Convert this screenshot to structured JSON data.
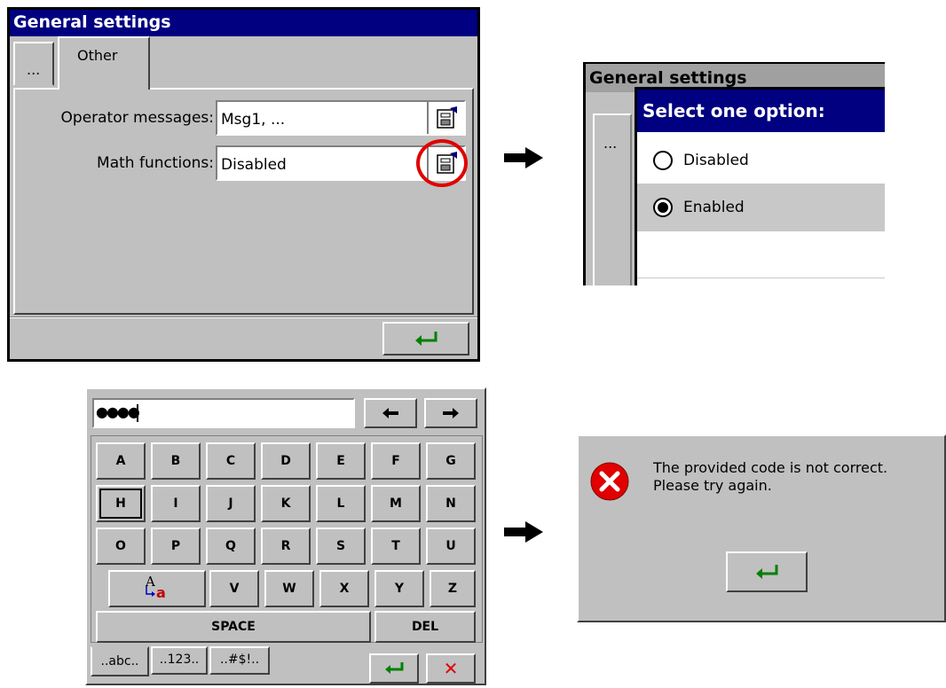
{
  "settings": {
    "title": "General settings",
    "tabs": [
      {
        "label": "..."
      },
      {
        "label": "Other"
      }
    ],
    "fields": [
      {
        "label": "Operator messages:",
        "value": "Msg1, ..."
      },
      {
        "label": "Math functions:",
        "value": "Disabled"
      }
    ],
    "highlight_color": "#e00000"
  },
  "select_dialog": {
    "bg_title_partial": "General settings",
    "bg_tab": "...",
    "title": "Select one option:",
    "options": [
      {
        "label": "Disabled",
        "selected": false
      },
      {
        "label": "Enabled",
        "selected": true
      }
    ]
  },
  "keyboard": {
    "password_value": "●●●●",
    "rows": [
      [
        "A",
        "B",
        "C",
        "D",
        "E",
        "F",
        "G"
      ],
      [
        "H",
        "I",
        "J",
        "K",
        "L",
        "M",
        "N"
      ],
      [
        "O",
        "P",
        "Q",
        "R",
        "S",
        "T",
        "U"
      ],
      [
        "V",
        "W",
        "X",
        "Y",
        "Z"
      ]
    ],
    "case_key": {
      "upper": "A",
      "lower": "a"
    },
    "space_label": "SPACE",
    "del_label": "DEL",
    "mode_tabs": [
      "..abc..",
      "..123..",
      "..#$!.."
    ],
    "cancel_symbol": "✕"
  },
  "error_dialog": {
    "line1": "The provided code is not correct.",
    "line2": "Please try again."
  },
  "colors": {
    "title_bar": "#000080",
    "window": "#c0c0c0",
    "enter_arrow": "#008000",
    "cancel": "#e00000"
  }
}
